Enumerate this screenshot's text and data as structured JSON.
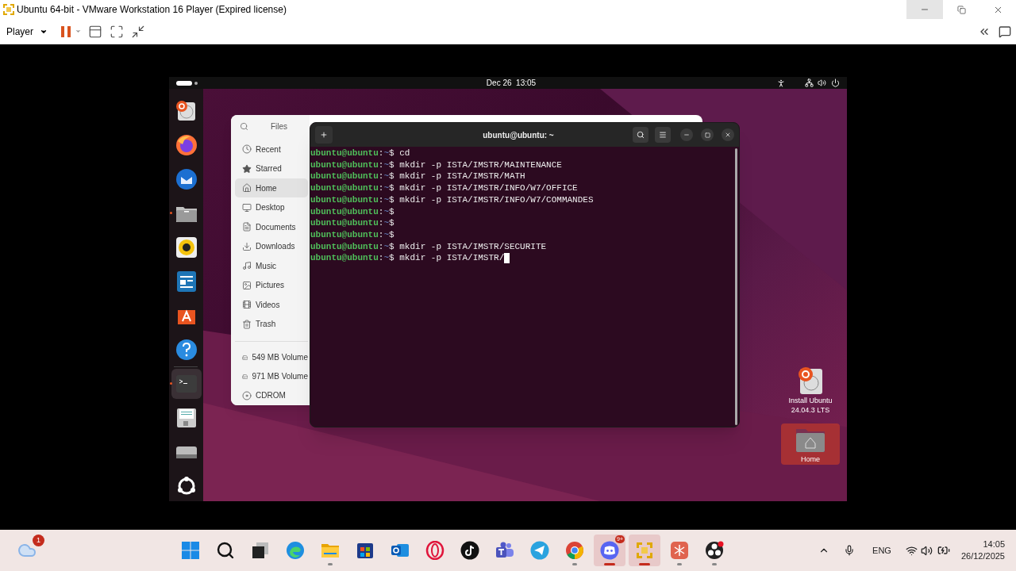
{
  "vmware": {
    "title": "Ubuntu 64-bit - VMware Workstation 16 Player (Expired license)",
    "player_menu": "Player",
    "paused": false
  },
  "ubuntu": {
    "clock": "Dec 26  13:05",
    "dock": [
      {
        "kind": "installer",
        "running": false,
        "focused": false
      },
      {
        "kind": "firefox",
        "running": false,
        "focused": false
      },
      {
        "kind": "thunderbird",
        "running": false,
        "focused": false
      },
      {
        "kind": "files",
        "running": true,
        "focused": false
      },
      {
        "kind": "rhythmbox",
        "running": false,
        "focused": false
      },
      {
        "kind": "writer",
        "running": false,
        "focused": false
      },
      {
        "kind": "appcenter",
        "running": false,
        "focused": false
      },
      {
        "kind": "help",
        "running": false,
        "focused": false
      },
      {
        "kind": "terminal",
        "running": true,
        "focused": true
      },
      {
        "kind": "floppy",
        "running": false,
        "focused": false
      },
      {
        "kind": "drive",
        "running": false,
        "focused": false
      },
      {
        "kind": "apps",
        "running": false,
        "focused": false
      }
    ],
    "files": {
      "title": "Files",
      "places": [
        {
          "kind": "recent",
          "label": "Recent",
          "selected": false
        },
        {
          "kind": "starred",
          "label": "Starred",
          "selected": false
        },
        {
          "kind": "home",
          "label": "Home",
          "selected": true
        },
        {
          "kind": "desktop",
          "label": "Desktop",
          "selected": false
        },
        {
          "kind": "documents",
          "label": "Documents",
          "selected": false
        },
        {
          "kind": "downloads",
          "label": "Downloads",
          "selected": false
        },
        {
          "kind": "music",
          "label": "Music",
          "selected": false
        },
        {
          "kind": "pictures",
          "label": "Pictures",
          "selected": false
        },
        {
          "kind": "videos",
          "label": "Videos",
          "selected": false
        },
        {
          "kind": "trash",
          "label": "Trash",
          "selected": false
        }
      ],
      "devices": [
        {
          "kind": "volume",
          "label": "549 MB Volume"
        },
        {
          "kind": "volume",
          "label": "971 MB Volume"
        },
        {
          "kind": "cdrom",
          "label": "CDROM"
        }
      ]
    },
    "terminal": {
      "title": "ubuntu@ubuntu: ~",
      "lines": [
        {
          "user": "ubuntu@ubuntu",
          "sep": ":",
          "path": "~",
          "symbol": "$",
          "command": "cd",
          "cursor": false
        },
        {
          "user": "ubuntu@ubuntu",
          "sep": ":",
          "path": "~",
          "symbol": "$",
          "command": "mkdir -p ISTA/IMSTR/MAINTENANCE",
          "cursor": false
        },
        {
          "user": "ubuntu@ubuntu",
          "sep": ":",
          "path": "~",
          "symbol": "$",
          "command": "mkdir -p ISTA/IMSTR/MATH",
          "cursor": false
        },
        {
          "user": "ubuntu@ubuntu",
          "sep": ":",
          "path": "~",
          "symbol": "$",
          "command": "mkdir -p ISTA/IMSTR/INFO/W7/OFFICE",
          "cursor": false
        },
        {
          "user": "ubuntu@ubuntu",
          "sep": ":",
          "path": "~",
          "symbol": "$",
          "command": "mkdir -p ISTA/IMSTR/INFO/W7/COMMANDES",
          "cursor": false
        },
        {
          "user": "ubuntu@ubuntu",
          "sep": ":",
          "path": "~",
          "symbol": "$",
          "cursor": false
        },
        {
          "user": "ubuntu@ubuntu",
          "sep": ":",
          "path": "~",
          "symbol": "$",
          "cursor": false
        },
        {
          "user": "ubuntu@ubuntu",
          "sep": ":",
          "path": "~",
          "symbol": "$",
          "cursor": false
        },
        {
          "user": "ubuntu@ubuntu",
          "sep": ":",
          "path": "~",
          "symbol": "$",
          "command": "mkdir -p ISTA/IMSTR/SECURITE",
          "cursor": false
        },
        {
          "user": "ubuntu@ubuntu",
          "sep": ":",
          "path": "~",
          "symbol": "$",
          "command": "mkdir -p ISTA/IMSTR/",
          "cursor": true
        }
      ]
    },
    "desktop_icons": [
      {
        "kind": "installer",
        "label": "Install Ubuntu 24.04.3 LTS",
        "selected": false
      },
      {
        "kind": "home",
        "label": "Home",
        "selected": true
      }
    ]
  },
  "taskbar": {
    "weather_badge": "1",
    "apps": [
      {
        "kind": "windows",
        "running": false,
        "active": false
      },
      {
        "kind": "search",
        "running": false,
        "active": false
      },
      {
        "kind": "taskview",
        "running": false,
        "active": false
      },
      {
        "kind": "edge",
        "running": false,
        "active": false
      },
      {
        "kind": "explorer",
        "running": true,
        "active": false
      },
      {
        "kind": "store",
        "running": false,
        "active": false
      },
      {
        "kind": "outlook",
        "running": false,
        "active": false
      },
      {
        "kind": "opera",
        "running": false,
        "active": false
      },
      {
        "kind": "tiktok",
        "running": false,
        "active": false
      },
      {
        "kind": "teams",
        "running": false,
        "active": false
      },
      {
        "kind": "telegram",
        "running": false,
        "active": false
      },
      {
        "kind": "chrome",
        "running": true,
        "active": false
      },
      {
        "kind": "discord",
        "running": true,
        "active": true,
        "badge": "9+"
      },
      {
        "kind": "vmware",
        "running": true,
        "active": true
      },
      {
        "kind": "redapp",
        "running": true,
        "active": false
      },
      {
        "kind": "obs",
        "running": true,
        "active": false
      }
    ],
    "language": "ENG",
    "time": "14:05",
    "date": "26/12/2025"
  }
}
